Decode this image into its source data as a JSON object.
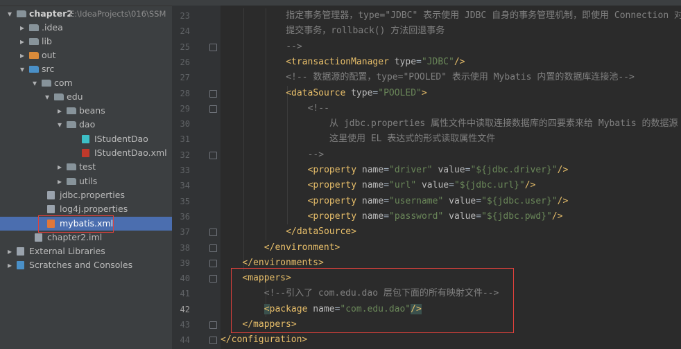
{
  "project_tree": {
    "items": [
      {
        "label": "chapter2",
        "path": "E:\\IdeaProjects\\016\\SSM",
        "icon": "module-folder-icon",
        "expanded": true
      },
      {
        "label": ".idea",
        "icon": "folder-icon",
        "expanded": false
      },
      {
        "label": "lib",
        "icon": "folder-icon",
        "expanded": false
      },
      {
        "label": "out",
        "icon": "folder-excluded-icon",
        "expanded": false
      },
      {
        "label": "src",
        "icon": "source-folder-icon",
        "expanded": true
      },
      {
        "label": "com",
        "icon": "package-icon",
        "expanded": true
      },
      {
        "label": "edu",
        "icon": "package-icon",
        "expanded": true
      },
      {
        "label": "beans",
        "icon": "package-icon",
        "expanded": false
      },
      {
        "label": "dao",
        "icon": "package-icon",
        "expanded": true
      },
      {
        "label": "IStudentDao",
        "icon": "interface-icon"
      },
      {
        "label": "IStudentDao.xml",
        "icon": "mybatis-xml-icon"
      },
      {
        "label": "test",
        "icon": "package-icon",
        "expanded": false
      },
      {
        "label": "utils",
        "icon": "package-icon",
        "expanded": false
      },
      {
        "label": "jdbc.properties",
        "icon": "properties-file-icon"
      },
      {
        "label": "log4j.properties",
        "icon": "properties-file-icon"
      },
      {
        "label": "mybatis.xml",
        "icon": "xml-file-icon",
        "selected": true
      },
      {
        "label": "chapter2.iml",
        "icon": "iml-file-icon"
      },
      {
        "label": "External Libraries",
        "icon": "libraries-icon",
        "expanded": false
      },
      {
        "label": "Scratches and Consoles",
        "icon": "scratches-icon",
        "expanded": false
      }
    ]
  },
  "editor": {
    "current_line": 42,
    "lines": [
      {
        "n": "23",
        "indent": 12,
        "parts": [
          {
            "c": "cmt",
            "t": "指定事务管理器，type=\"JDBC\" 表示使用 JDBC 自身的事务管理机制，即使用 Connection 对"
          }
        ]
      },
      {
        "n": "24",
        "indent": 12,
        "parts": [
          {
            "c": "cmt",
            "t": "提交事务，rollback() 方法回退事务"
          }
        ]
      },
      {
        "n": "25",
        "indent": 12,
        "parts": [
          {
            "c": "cmt",
            "t": "-->"
          }
        ]
      },
      {
        "n": "26",
        "indent": 12,
        "parts": [
          {
            "c": "tag",
            "t": "<transactionManager "
          },
          {
            "c": "attr",
            "t": "type"
          },
          {
            "c": "",
            "t": "="
          },
          {
            "c": "val",
            "t": "\"JDBC\""
          },
          {
            "c": "tag",
            "t": "/>"
          }
        ]
      },
      {
        "n": "27",
        "indent": 12,
        "parts": [
          {
            "c": "cmt",
            "t": "<!-- 数据源的配置，type=\"POOLED\" 表示使用 Mybatis 内置的数据库连接池-->"
          }
        ]
      },
      {
        "n": "28",
        "indent": 12,
        "parts": [
          {
            "c": "tag",
            "t": "<dataSource "
          },
          {
            "c": "attr",
            "t": "type"
          },
          {
            "c": "",
            "t": "="
          },
          {
            "c": "val",
            "t": "\"POOLED\""
          },
          {
            "c": "tag",
            "t": ">"
          }
        ]
      },
      {
        "n": "29",
        "indent": 16,
        "parts": [
          {
            "c": "cmt",
            "t": "<!--"
          }
        ]
      },
      {
        "n": "30",
        "indent": 20,
        "parts": [
          {
            "c": "cmt",
            "t": "从 jdbc.properties 属性文件中读取连接数据库的四要素来给 Mybatis 的数据源"
          }
        ]
      },
      {
        "n": "31",
        "indent": 20,
        "parts": [
          {
            "c": "cmt",
            "t": "这里使用 EL 表达式的形式读取属性文件"
          }
        ]
      },
      {
        "n": "32",
        "indent": 16,
        "parts": [
          {
            "c": "cmt",
            "t": "-->"
          }
        ]
      },
      {
        "n": "33",
        "indent": 16,
        "parts": [
          {
            "c": "tag",
            "t": "<property "
          },
          {
            "c": "attr",
            "t": "name"
          },
          {
            "c": "",
            "t": "="
          },
          {
            "c": "val",
            "t": "\"driver\""
          },
          {
            "c": "",
            "t": " "
          },
          {
            "c": "attr",
            "t": "value"
          },
          {
            "c": "",
            "t": "="
          },
          {
            "c": "val",
            "t": "\"${jdbc.driver}\""
          },
          {
            "c": "tag",
            "t": "/>"
          }
        ]
      },
      {
        "n": "34",
        "indent": 16,
        "parts": [
          {
            "c": "tag",
            "t": "<property "
          },
          {
            "c": "attr",
            "t": "name"
          },
          {
            "c": "",
            "t": "="
          },
          {
            "c": "val",
            "t": "\"url\""
          },
          {
            "c": "",
            "t": " "
          },
          {
            "c": "attr",
            "t": "value"
          },
          {
            "c": "",
            "t": "="
          },
          {
            "c": "val",
            "t": "\"${jdbc.url}\""
          },
          {
            "c": "tag",
            "t": "/>"
          }
        ]
      },
      {
        "n": "35",
        "indent": 16,
        "parts": [
          {
            "c": "tag",
            "t": "<property "
          },
          {
            "c": "attr",
            "t": "name"
          },
          {
            "c": "",
            "t": "="
          },
          {
            "c": "val",
            "t": "\"username\""
          },
          {
            "c": "",
            "t": " "
          },
          {
            "c": "attr",
            "t": "value"
          },
          {
            "c": "",
            "t": "="
          },
          {
            "c": "val",
            "t": "\"${jdbc.user}\""
          },
          {
            "c": "tag",
            "t": "/>"
          }
        ]
      },
      {
        "n": "36",
        "indent": 16,
        "parts": [
          {
            "c": "tag",
            "t": "<property "
          },
          {
            "c": "attr",
            "t": "name"
          },
          {
            "c": "",
            "t": "="
          },
          {
            "c": "val",
            "t": "\"password\""
          },
          {
            "c": "",
            "t": " "
          },
          {
            "c": "attr",
            "t": "value"
          },
          {
            "c": "",
            "t": "="
          },
          {
            "c": "val",
            "t": "\"${jdbc.pwd}\""
          },
          {
            "c": "tag",
            "t": "/>"
          }
        ]
      },
      {
        "n": "37",
        "indent": 12,
        "parts": [
          {
            "c": "tag",
            "t": "</dataSource>"
          }
        ]
      },
      {
        "n": "38",
        "indent": 8,
        "parts": [
          {
            "c": "tag",
            "t": "</environment>"
          }
        ]
      },
      {
        "n": "39",
        "indent": 4,
        "parts": [
          {
            "c": "tag",
            "t": "</environments>"
          }
        ]
      },
      {
        "n": "40",
        "indent": 4,
        "parts": [
          {
            "c": "tag",
            "t": "<mappers>"
          }
        ]
      },
      {
        "n": "41",
        "indent": 8,
        "parts": [
          {
            "c": "cmt",
            "t": "<!--引入了 com.edu.dao 层包下面的所有映射文件-->"
          }
        ]
      },
      {
        "n": "42",
        "indent": 8,
        "parts": [
          {
            "c": "tag hlbrk",
            "t": "<"
          },
          {
            "c": "tag",
            "t": "package "
          },
          {
            "c": "attr",
            "t": "name"
          },
          {
            "c": "",
            "t": "="
          },
          {
            "c": "val",
            "t": "\"com.edu.dao\""
          },
          {
            "c": "tag hlbrk",
            "t": "/>"
          }
        ]
      },
      {
        "n": "43",
        "indent": 4,
        "parts": [
          {
            "c": "tag",
            "t": "</mappers>"
          }
        ]
      },
      {
        "n": "44",
        "indent": 0,
        "parts": [
          {
            "c": "tag",
            "t": "</configuration>"
          }
        ]
      }
    ]
  }
}
